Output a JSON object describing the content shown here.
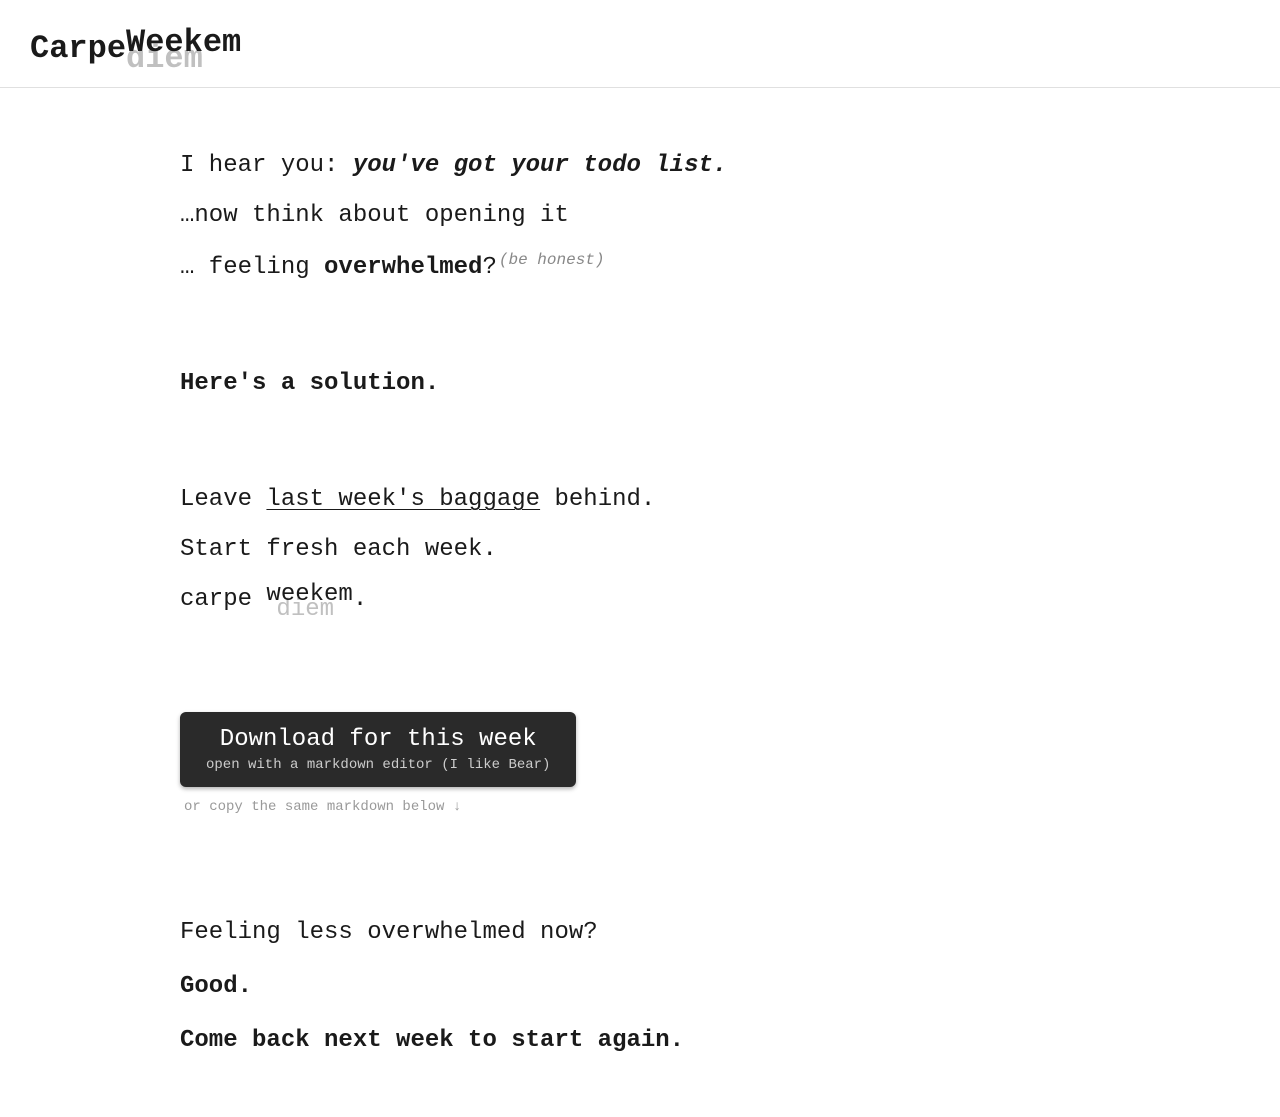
{
  "header": {
    "prefix": "Carpe ",
    "weekem_word": "Weekem",
    "diem_word": "diem"
  },
  "intro": {
    "lead_in": "I hear you: ",
    "emphasis": "you've got your todo list.",
    "line2": "…now think about opening it",
    "line3_prefix": "… feeling ",
    "line3_bold": "overwhelmed",
    "line3_suffix": "?",
    "aside": "(be honest)"
  },
  "solution": {
    "heading": "Here's a solution.",
    "line1_prefix": "Leave ",
    "line1_underlined": "last week's baggage",
    "line1_suffix": " behind.",
    "line2": "Start fresh each week.",
    "line3_prefix": "carpe ",
    "weekem_word": "weekem",
    "diem_word": "diem",
    "line3_suffix": "."
  },
  "download": {
    "button_title": "Download for this week",
    "button_subtitle": "open with a markdown editor (I like Bear)",
    "copy_hint": "or copy the same markdown below ↓"
  },
  "closing": {
    "line1": "Feeling less overwhelmed now?",
    "line2": "Good.",
    "line3": "Come back next week to start again."
  }
}
